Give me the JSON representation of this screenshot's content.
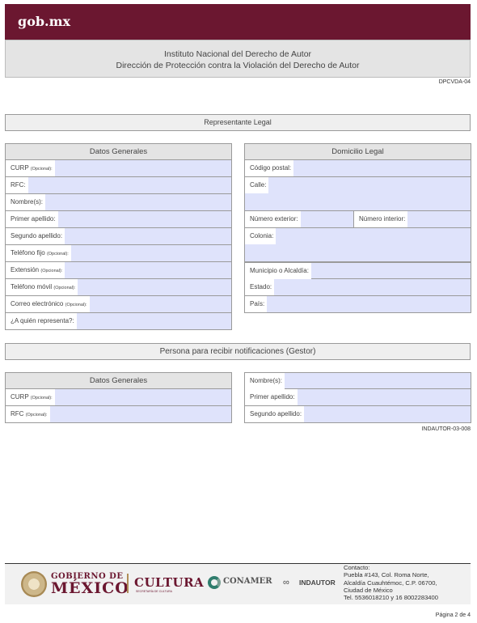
{
  "header": {
    "brand": "gob.mx"
  },
  "institution": {
    "line1": "Instituto Nacional del Derecho de Autor",
    "line2": "Dirección de Protección contra la Violación del Derecho de Autor"
  },
  "form_code_top": "DPCVDA-04",
  "representante": {
    "section_title": "Representante Legal",
    "datos_generales": {
      "title": "Datos Generales",
      "fields": [
        {
          "label": "CURP",
          "optional": "(Opcional):"
        },
        {
          "label": "RFC:",
          "optional": ""
        },
        {
          "label": "Nombre(s):",
          "optional": ""
        },
        {
          "label": "Primer apellido:",
          "optional": ""
        },
        {
          "label": "Segundo apellido:",
          "optional": ""
        },
        {
          "label": "Teléfono fijo",
          "optional": "(Opcional):"
        },
        {
          "label": "Extensión",
          "optional": "(Opcional):"
        },
        {
          "label": "Teléfono móvil",
          "optional": "(Opcional):"
        },
        {
          "label": "Correo electrónico",
          "optional": "(Opcional):"
        },
        {
          "label": "¿A quién representa?:",
          "optional": ""
        }
      ]
    },
    "domicilio": {
      "title": "Domicilio Legal",
      "codigo_postal": "Código postal:",
      "calle": "Calle:",
      "numero_exterior": "Número exterior:",
      "numero_interior": "Número interior:",
      "colonia": "Colonia:",
      "municipio": "Municipio o Alcaldía:",
      "estado": "Estado:",
      "pais": "País:"
    }
  },
  "gestor": {
    "section_title": "Persona para recibir notificaciones (Gestor)",
    "datos_generales": {
      "title": "Datos Generales",
      "fields": [
        {
          "label": "CURP",
          "optional": "(Opcional):"
        },
        {
          "label": "RFC",
          "optional": "(Opcional):"
        }
      ]
    },
    "right_fields": [
      {
        "label": "Nombre(s):"
      },
      {
        "label": "Primer apellido:"
      },
      {
        "label": "Segundo apellido:"
      }
    ]
  },
  "form_code_bottom": "INDAUTOR-03-008",
  "footer": {
    "gob_line1": "GOBIERNO DE",
    "gob_line2": "MÉXICO",
    "cultura": "CULTURA",
    "cultura_sub": "SECRETARÍA DE CULTURA",
    "conamer": "CONAMER",
    "indautor": "INDAUTOR",
    "contact_lines": [
      "Contacto:",
      "Puebla #143, Col. Roma Norte,",
      "Alcaldía Cuauhtémoc, C.P. 06700,",
      "Ciudad de México",
      "Tel. 5536018210 y 16  8002283400"
    ]
  },
  "page_number": "Página 2 de 4"
}
